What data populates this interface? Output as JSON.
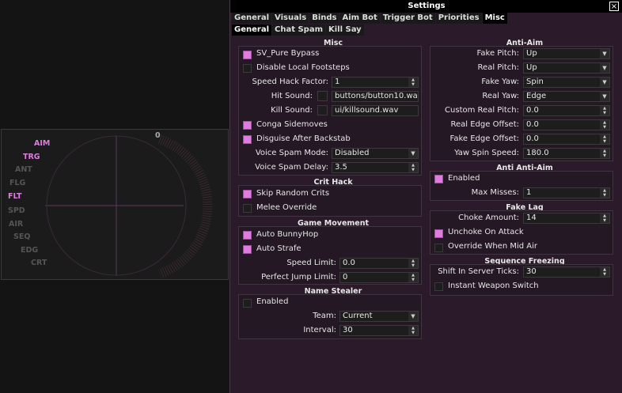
{
  "radar": {
    "labels": [
      "AIM",
      "TRG",
      "ANT",
      "FLG",
      "FLT",
      "SPD",
      "AIR",
      "SEQ",
      "EDG",
      "CRT"
    ],
    "active_labels": [
      "AIM",
      "TRG",
      "FLT"
    ],
    "zero_label": "0"
  },
  "window": {
    "title": "Settings",
    "close_glyph": "×"
  },
  "tabs": [
    "General",
    "Visuals",
    "Binds",
    "Aim Bot",
    "Trigger Bot",
    "Priorities",
    "Misc"
  ],
  "subtabs": [
    "General",
    "Chat Spam",
    "Kill Say"
  ],
  "misc": {
    "title": "Misc",
    "sv_pure_bypass": "SV_Pure Bypass",
    "disable_footsteps": "Disable Local Footsteps",
    "speed_hack_label": "Speed Hack Factor:",
    "speed_hack_value": "1",
    "hit_sound_label": "Hit Sound:",
    "hit_sound_value": "buttons/button10.wa",
    "kill_sound_label": "Kill Sound:",
    "kill_sound_value": "ui/killsound.wav",
    "conga": "Conga Sidemoves",
    "disguise": "Disguise After Backstab",
    "voice_mode_label": "Voice Spam Mode:",
    "voice_mode_value": "Disabled",
    "voice_delay_label": "Voice Spam Delay:",
    "voice_delay_value": "3.5"
  },
  "crit": {
    "title": "Crit Hack",
    "skip": "Skip Random Crits",
    "melee": "Melee Override"
  },
  "movement": {
    "title": "Game Movement",
    "bhop": "Auto BunnyHop",
    "strafe": "Auto Strafe",
    "speed_limit_label": "Speed Limit:",
    "speed_limit_value": "0.0",
    "perfect_jump_label": "Perfect Jump Limit:",
    "perfect_jump_value": "0"
  },
  "name_stealer": {
    "title": "Name Stealer",
    "enabled": "Enabled",
    "team_label": "Team:",
    "team_value": "Current",
    "interval_label": "Interval:",
    "interval_value": "30"
  },
  "antiaim": {
    "title": "Anti-Aim",
    "fake_pitch_label": "Fake Pitch:",
    "fake_pitch_value": "Up",
    "real_pitch_label": "Real Pitch:",
    "real_pitch_value": "Up",
    "fake_yaw_label": "Fake Yaw:",
    "fake_yaw_value": "Spin",
    "real_yaw_label": "Real Yaw:",
    "real_yaw_value": "Edge",
    "custom_real_pitch_label": "Custom Real Pitch:",
    "custom_real_pitch_value": "0.0",
    "real_edge_label": "Real Edge Offset:",
    "real_edge_value": "0.0",
    "fake_edge_label": "Fake Edge Offset:",
    "fake_edge_value": "0.0",
    "yaw_spin_label": "Yaw Spin Speed:",
    "yaw_spin_value": "180.0"
  },
  "anti_antiaim": {
    "title": "Anti Anti-Aim",
    "enabled": "Enabled",
    "max_misses_label": "Max Misses:",
    "max_misses_value": "1"
  },
  "fakelag": {
    "title": "Fake Lag",
    "choke_label": "Choke Amount:",
    "choke_value": "14",
    "unchoke": "Unchoke On Attack",
    "override_air": "Override When Mid Air"
  },
  "seqfreeze": {
    "title": "Sequence Freezing",
    "shift_label": "Shift In Server Ticks:",
    "shift_value": "30",
    "instant_switch": "Instant Weapon Switch"
  },
  "colors": {
    "accent": "#e07ce0",
    "panel_bg": "#241824",
    "window_bg": "#2a1a2a",
    "radar_active": "#e07ce0",
    "radar_inactive": "#555555"
  }
}
